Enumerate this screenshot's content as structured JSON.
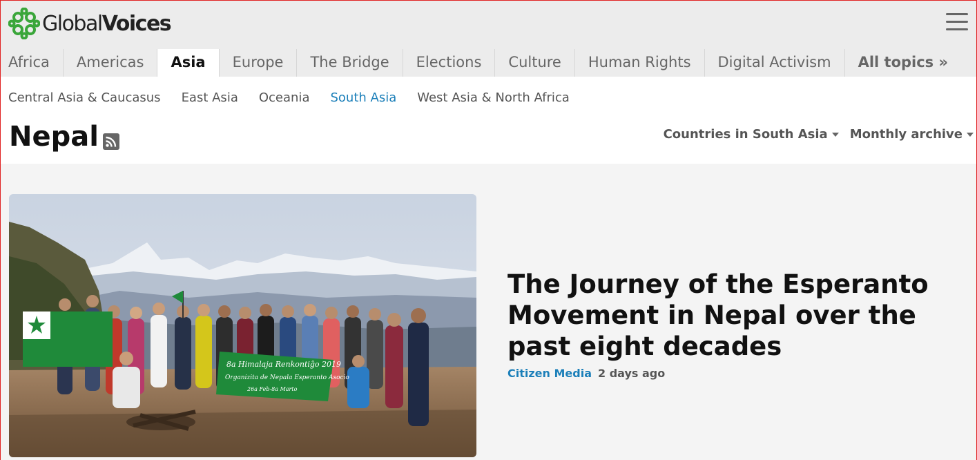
{
  "logo": {
    "text_regular": "Global",
    "text_bold": "Voices"
  },
  "main_nav": [
    {
      "label": "Africa"
    },
    {
      "label": "Americas"
    },
    {
      "label": "Asia",
      "active": true
    },
    {
      "label": "Europe"
    },
    {
      "label": "The Bridge"
    },
    {
      "label": "Elections"
    },
    {
      "label": "Culture"
    },
    {
      "label": "Human Rights"
    },
    {
      "label": "Digital Activism"
    },
    {
      "label": "All topics »"
    }
  ],
  "sub_nav": [
    {
      "label": "Central Asia & Caucasus"
    },
    {
      "label": "East Asia"
    },
    {
      "label": "Oceania"
    },
    {
      "label": "South Asia",
      "active": true
    },
    {
      "label": "West Asia & North Africa"
    }
  ],
  "page": {
    "title": "Nepal",
    "dropdown_countries": "Countries in South Asia",
    "dropdown_archive": "Monthly archive"
  },
  "article": {
    "headline": "The Journey of the Esperanto Movement in Nepal over the past eight decades",
    "category": "Citizen Media",
    "time": "2 days ago",
    "banner_line1": "8a Himalaja Renkontiĝo 2019",
    "banner_line2": "Organizita de Nepala Esperanto Asocio",
    "banner_line3": "26a Feb-8a Marto"
  },
  "colors": {
    "accent": "#1b7fb9",
    "logo_green": "#3aa63a",
    "esperanto_green": "#1f8a3a"
  }
}
